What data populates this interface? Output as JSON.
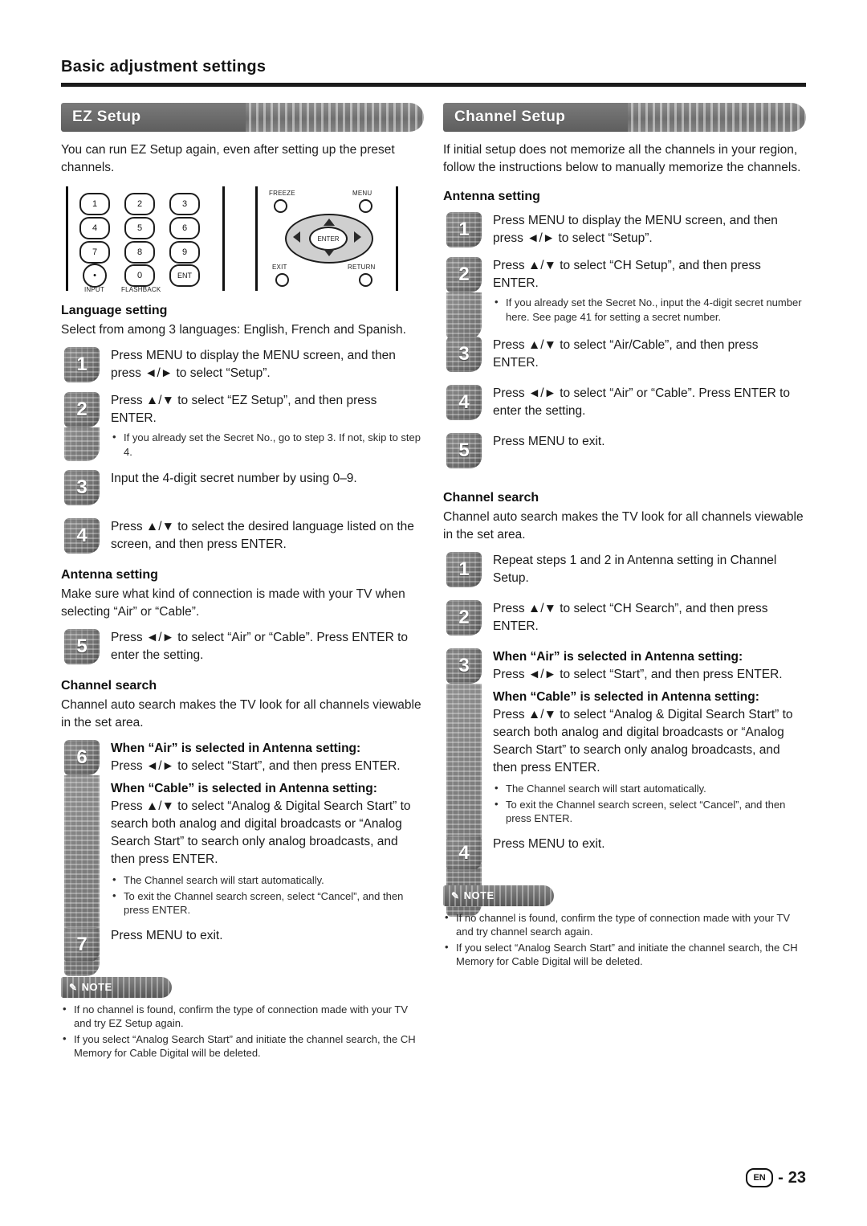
{
  "header": {
    "title": "Basic adjustment settings"
  },
  "footer": {
    "locale_badge": "EN",
    "separator": "-",
    "page_number": "23"
  },
  "left": {
    "banner": "EZ Setup",
    "intro": "You can run EZ Setup again, even after setting up the preset channels.",
    "remote": {
      "keys": [
        "1",
        "2",
        "3",
        "4",
        "5",
        "6",
        "7",
        "8",
        "9",
        "0"
      ],
      "dot_key": "•",
      "ent_key": "ENT",
      "input_label": "INPUT",
      "flashback_label": "FLASHBACK",
      "freeze_label": "FREEZE",
      "menu_label": "MENU",
      "exit_label": "EXIT",
      "return_label": "RETURN",
      "enter_label": "ENTER"
    },
    "language_heading": "Language setting",
    "language_text": "Select from among 3 languages: English, French and Spanish.",
    "steps": [
      {
        "num": "1",
        "text": "Press MENU to display the MENU screen, and then press ◄/► to select “Setup”."
      },
      {
        "num": "2",
        "text": "Press ▲/▼ to select “EZ Setup”, and then press ENTER.",
        "bullets": [
          "If you already set the Secret No., go to step 3. If not, skip to step 4."
        ]
      },
      {
        "num": "3",
        "text": "Input the 4-digit secret number by using 0–9."
      },
      {
        "num": "4",
        "text": "Press ▲/▼ to select the desired language listed on the screen, and then press ENTER."
      }
    ],
    "antenna_heading": "Antenna setting",
    "antenna_text": "Make sure what kind of connection is made with your TV when selecting “Air” or “Cable”.",
    "antenna_step": {
      "num": "5",
      "text": "Press ◄/► to select “Air” or “Cable”. Press ENTER to enter the setting."
    },
    "search_heading": "Channel search",
    "search_text": "Channel auto search makes the TV look for all channels viewable in the set area.",
    "search_step": {
      "num": "6",
      "air_head": "When “Air” is selected in Antenna setting:",
      "air_text": "Press ◄/► to select “Start”, and then press ENTER.",
      "cable_head": "When “Cable” is selected in Antenna setting:",
      "cable_text": "Press ▲/▼ to select “Analog & Digital Search Start” to search both analog and digital broadcasts or “Analog Search Start” to search only analog broadcasts, and then press ENTER.",
      "bullets": [
        "The Channel search will start automatically.",
        "To exit the Channel search screen, select “Cancel”, and then press ENTER."
      ]
    },
    "exit_step": {
      "num": "7",
      "text": "Press MENU to exit."
    },
    "note_label": "NOTE",
    "notes": [
      "If no channel is found, confirm the type of connection made with your TV and try EZ Setup again.",
      "If you select “Analog Search Start” and initiate the channel search, the CH Memory for Cable Digital will be deleted."
    ]
  },
  "right": {
    "banner": "Channel Setup",
    "intro": "If initial setup does not memorize all the channels in your region, follow the instructions below to manually memorize the channels.",
    "antenna_heading": "Antenna setting",
    "steps": [
      {
        "num": "1",
        "text": "Press MENU to display the MENU screen, and then press ◄/► to select “Setup”."
      },
      {
        "num": "2",
        "text": "Press ▲/▼ to select “CH Setup”, and then press ENTER.",
        "bullets": [
          "If you already set the Secret No., input the 4-digit secret number here. See page 41 for setting a secret number."
        ]
      },
      {
        "num": "3",
        "text": "Press ▲/▼ to select “Air/Cable”, and then press ENTER."
      },
      {
        "num": "4",
        "text": "Press ◄/► to select “Air” or “Cable”. Press ENTER to enter the setting."
      },
      {
        "num": "5",
        "text": "Press MENU to exit."
      }
    ],
    "search_heading": "Channel search",
    "search_text": "Channel auto search makes the TV look for all channels viewable in the set area.",
    "search_steps": [
      {
        "num": "1",
        "text": "Repeat steps 1 and 2 in Antenna setting in Channel Setup."
      },
      {
        "num": "2",
        "text": "Press ▲/▼ to select “CH Search”, and then press ENTER."
      }
    ],
    "search_step3": {
      "num": "3",
      "air_head": "When “Air” is selected in Antenna setting:",
      "air_text": "Press ◄/► to select “Start”, and then press ENTER.",
      "cable_head": "When “Cable” is selected in Antenna setting:",
      "cable_text": "Press ▲/▼ to select “Analog & Digital Search Start” to search both analog and digital broadcasts or “Analog Search Start” to search only analog broadcasts, and then press ENTER.",
      "bullets": [
        "The Channel search will start automatically.",
        "To exit the Channel search screen, select “Cancel”, and then press ENTER."
      ]
    },
    "exit_step": {
      "num": "4",
      "text": "Press MENU to exit."
    },
    "note_label": "NOTE",
    "notes": [
      "If no channel is found, confirm the type of connection made with your TV and try channel search again.",
      "If you select “Analog Search Start” and initiate the channel search, the CH Memory for Cable Digital will be deleted."
    ]
  }
}
